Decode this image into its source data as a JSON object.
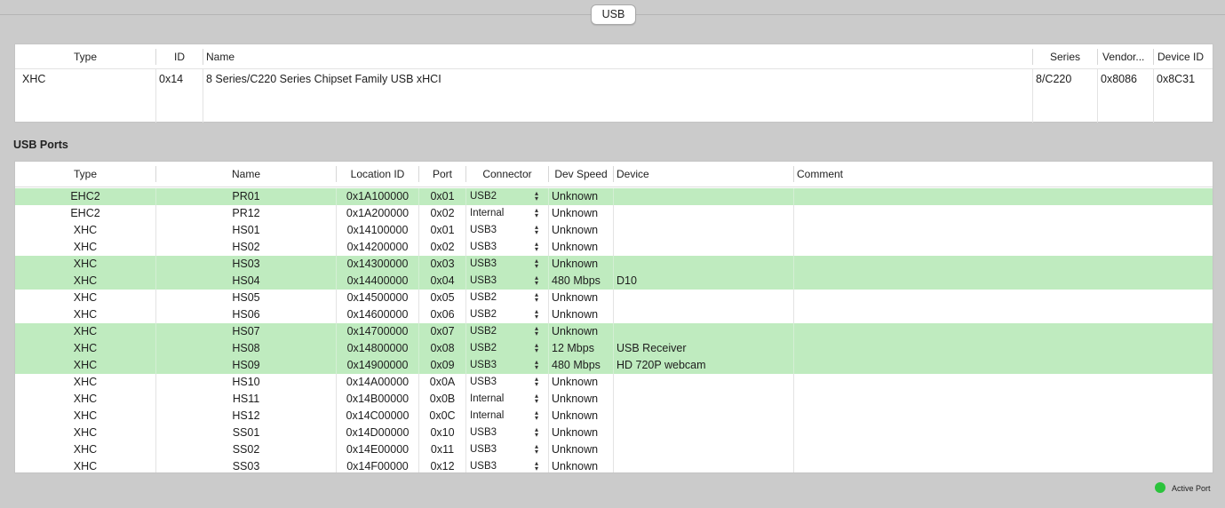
{
  "tab": {
    "label": "USB"
  },
  "controllers": {
    "columns": [
      "Type",
      "ID",
      "Name",
      "Series",
      "Vendor...",
      "Device ID"
    ],
    "rows": [
      {
        "type": "XHC",
        "id": "0x14",
        "name": "8 Series/C220 Series Chipset Family USB xHCI",
        "series": "8/C220",
        "vendor": "0x8086",
        "device_id": "0x8C31"
      }
    ]
  },
  "ports_section": {
    "title": "USB Ports"
  },
  "ports": {
    "columns": [
      "Type",
      "Name",
      "Location ID",
      "Port",
      "Connector",
      "Dev Speed",
      "Device",
      "Comment"
    ],
    "rows": [
      {
        "type": "EHC2",
        "name": "PR01",
        "location": "0x1A100000",
        "port": "0x01",
        "connector": "USB2",
        "speed": "Unknown",
        "device": "",
        "comment": "",
        "active": true
      },
      {
        "type": "EHC2",
        "name": "PR12",
        "location": "0x1A200000",
        "port": "0x02",
        "connector": "Internal",
        "speed": "Unknown",
        "device": "",
        "comment": "",
        "active": false
      },
      {
        "type": "XHC",
        "name": "HS01",
        "location": "0x14100000",
        "port": "0x01",
        "connector": "USB3",
        "speed": "Unknown",
        "device": "",
        "comment": "",
        "active": false
      },
      {
        "type": "XHC",
        "name": "HS02",
        "location": "0x14200000",
        "port": "0x02",
        "connector": "USB3",
        "speed": "Unknown",
        "device": "",
        "comment": "",
        "active": false
      },
      {
        "type": "XHC",
        "name": "HS03",
        "location": "0x14300000",
        "port": "0x03",
        "connector": "USB3",
        "speed": "Unknown",
        "device": "",
        "comment": "",
        "active": true
      },
      {
        "type": "XHC",
        "name": "HS04",
        "location": "0x14400000",
        "port": "0x04",
        "connector": "USB3",
        "speed": "480 Mbps",
        "device": "D10",
        "comment": "",
        "active": true
      },
      {
        "type": "XHC",
        "name": "HS05",
        "location": "0x14500000",
        "port": "0x05",
        "connector": "USB2",
        "speed": "Unknown",
        "device": "",
        "comment": "",
        "active": false
      },
      {
        "type": "XHC",
        "name": "HS06",
        "location": "0x14600000",
        "port": "0x06",
        "connector": "USB2",
        "speed": "Unknown",
        "device": "",
        "comment": "",
        "active": false
      },
      {
        "type": "XHC",
        "name": "HS07",
        "location": "0x14700000",
        "port": "0x07",
        "connector": "USB2",
        "speed": "Unknown",
        "device": "",
        "comment": "",
        "active": true
      },
      {
        "type": "XHC",
        "name": "HS08",
        "location": "0x14800000",
        "port": "0x08",
        "connector": "USB2",
        "speed": "12 Mbps",
        "device": "USB Receiver",
        "comment": "",
        "active": true
      },
      {
        "type": "XHC",
        "name": "HS09",
        "location": "0x14900000",
        "port": "0x09",
        "connector": "USB3",
        "speed": "480 Mbps",
        "device": "HD 720P webcam",
        "comment": "",
        "active": true
      },
      {
        "type": "XHC",
        "name": "HS10",
        "location": "0x14A00000",
        "port": "0x0A",
        "connector": "USB3",
        "speed": "Unknown",
        "device": "",
        "comment": "",
        "active": false
      },
      {
        "type": "XHC",
        "name": "HS11",
        "location": "0x14B00000",
        "port": "0x0B",
        "connector": "Internal",
        "speed": "Unknown",
        "device": "",
        "comment": "",
        "active": false
      },
      {
        "type": "XHC",
        "name": "HS12",
        "location": "0x14C00000",
        "port": "0x0C",
        "connector": "Internal",
        "speed": "Unknown",
        "device": "",
        "comment": "",
        "active": false
      },
      {
        "type": "XHC",
        "name": "SS01",
        "location": "0x14D00000",
        "port": "0x10",
        "connector": "USB3",
        "speed": "Unknown",
        "device": "",
        "comment": "",
        "active": false
      },
      {
        "type": "XHC",
        "name": "SS02",
        "location": "0x14E00000",
        "port": "0x11",
        "connector": "USB3",
        "speed": "Unknown",
        "device": "",
        "comment": "",
        "active": false
      },
      {
        "type": "XHC",
        "name": "SS03",
        "location": "0x14F00000",
        "port": "0x12",
        "connector": "USB3",
        "speed": "Unknown",
        "device": "",
        "comment": "",
        "active": false
      }
    ]
  },
  "legend": {
    "label": "Active Port",
    "color": "#2bc33c"
  },
  "colors": {
    "active_row": "#bfebbf",
    "background": "#cbcbcb"
  }
}
